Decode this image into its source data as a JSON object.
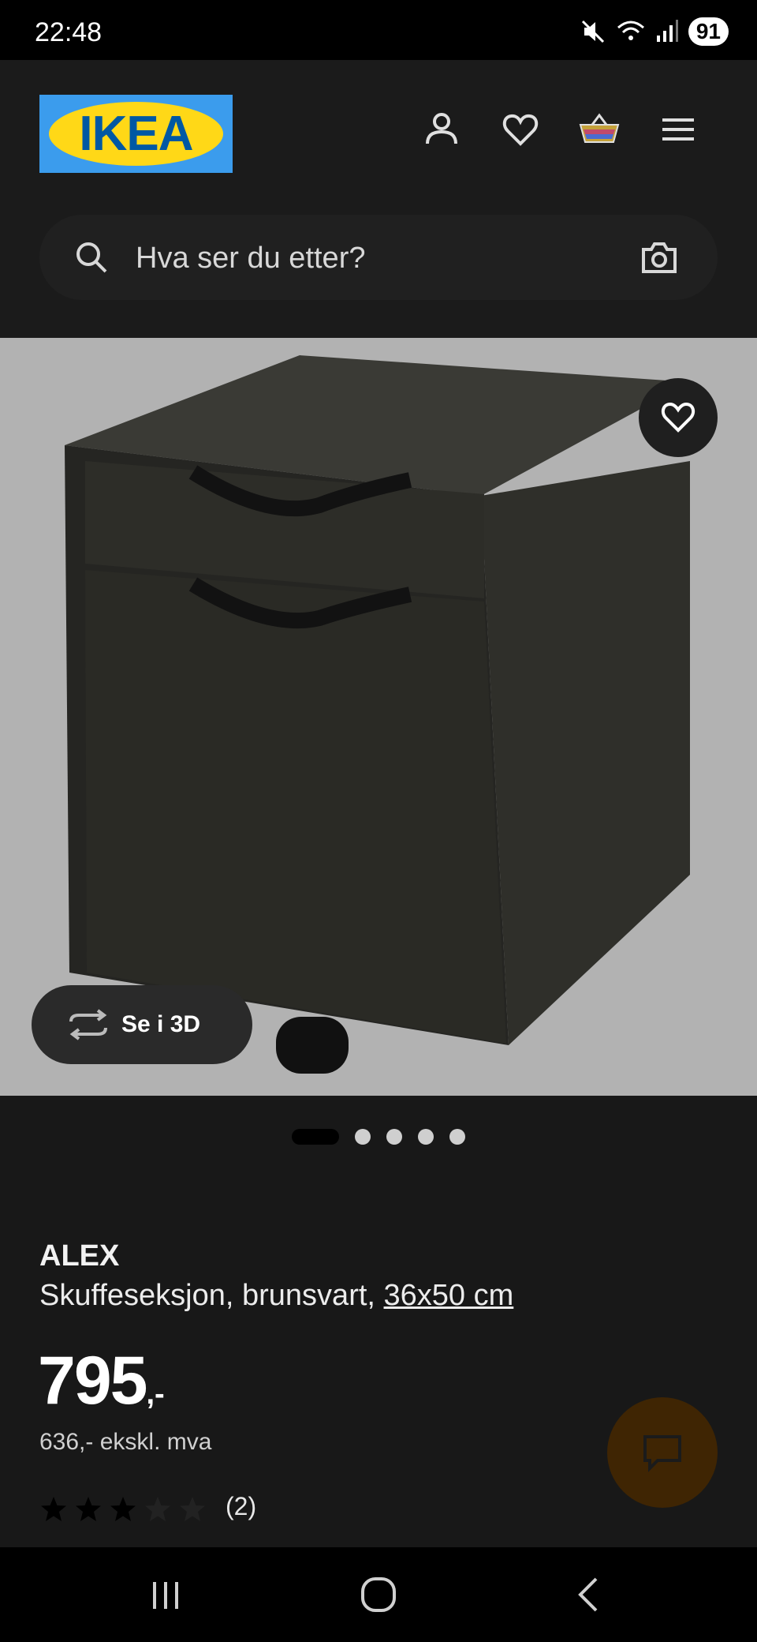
{
  "status_bar": {
    "time": "22:48",
    "battery": "91",
    "icons": [
      "mute-icon",
      "wifi-icon",
      "signal-icon"
    ]
  },
  "header": {
    "logo_text": "IKEA",
    "logo_colors": {
      "background": "#3b9ced",
      "oval": "#ffd817",
      "text": "#0058a3"
    },
    "icons": [
      "account-icon",
      "heart-icon",
      "shopping-bag-icon",
      "menu-icon"
    ]
  },
  "search": {
    "placeholder": "Hva ser du etter?",
    "icons": [
      "search-icon",
      "camera-icon"
    ]
  },
  "gallery": {
    "view_3d_label": "Se i 3D",
    "image_count": 5,
    "active_index": 0,
    "favorite_icon": "heart-icon"
  },
  "product": {
    "name": "ALEX",
    "description": "Skuffeseksjon, brunsvart, ",
    "size": "36x50 cm",
    "price_main": "795",
    "price_suffix": ",-",
    "price_ex_vat": "636,- ekskl. mva",
    "rating": 3,
    "rating_max": 5,
    "review_count": "(2)"
  },
  "chat": {
    "icon": "chat-icon",
    "color": "#3f2503"
  },
  "system_nav": [
    "recents-icon",
    "home-icon",
    "back-icon"
  ]
}
